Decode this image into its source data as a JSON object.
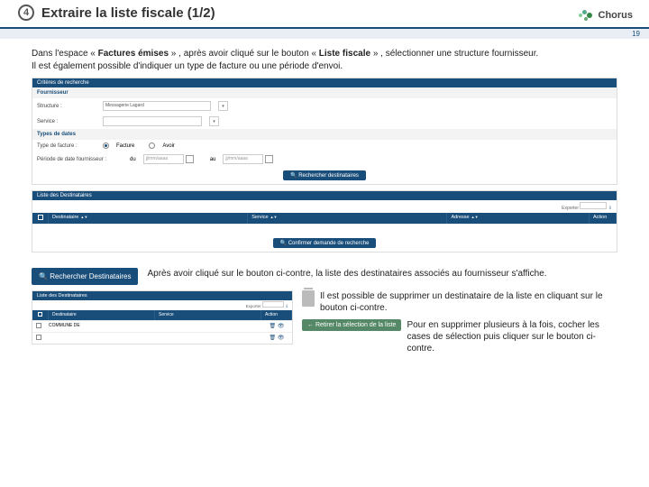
{
  "step_number": "4",
  "title": "Extraire la liste fiscale (1/2)",
  "logo_text": "Chorus",
  "page_number": "19",
  "intro_before_b1": "Dans l'espace « ",
  "intro_b1": "Factures émises",
  "intro_mid": " » , après avoir cliqué sur le bouton « ",
  "intro_b2": "Liste fiscale",
  "intro_after_b2": " » , sélectionner une structure fournisseur.",
  "intro_line2": "Il est également possible d'indiquer un type de facture ou une période d'envoi.",
  "panel1_head": "Critères de recherche",
  "sub_fournisseur": "Fournisseur",
  "lbl_structure": "Structure :",
  "val_structure": "Messagerie Lagard",
  "lbl_service": "Service :",
  "sub_types": "Types de dates",
  "lbl_type_facture": "Type de facture :",
  "radio_facture": "Facture",
  "radio_avoir": "Avoir",
  "lbl_periode": "Période de date fournisseur :",
  "lbl_du": "du",
  "date_ph": "jj/mm/aaaa",
  "lbl_au": "au",
  "btn_rechercher_dest": "Rechercher destinataires",
  "panel2_head": "Liste des Destinataires",
  "export_lbl": "Exporter",
  "th_check": "",
  "th_destinataire": "Destinataire",
  "th_service": "Service",
  "th_adresse": "Adresse",
  "th_action": "Action",
  "btn_telecharger": "Confirmer demande de recherche",
  "big_search_btn": "Rechercher Destinataires",
  "big_search_icon": "🔍",
  "caption_after_search": "Après avoir cliqué sur le bouton ci-contre, la liste des destinataires associés au fournisseur s'affiche.",
  "panel3_head": "Liste des Destinataires",
  "row_dest": "COMMUNE DE",
  "trash_caption": "Il est possible de supprimer un destinataire de la liste en cliquant sur le bouton ci-contre.",
  "retire_btn": "← Retirer la sélection de la liste",
  "retire_caption": "Pour en supprimer plusieurs à la fois, cocher les cases de sélection puis cliquer sur le bouton ci-contre."
}
